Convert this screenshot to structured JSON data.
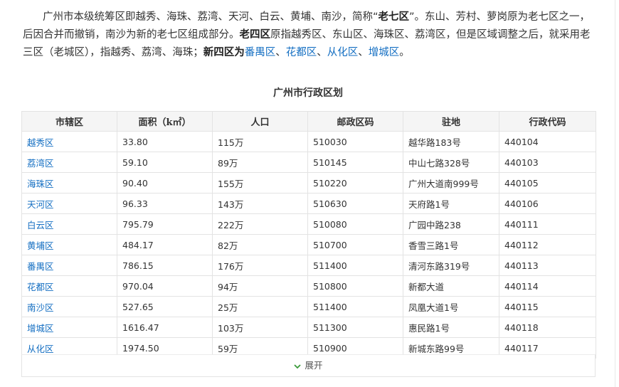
{
  "intro": {
    "p1": "广州市本级统筹区即越秀、海珠、荔湾、天河、白云、黄埔、南沙，简称“",
    "b1": "老七区",
    "p2": "”。东山、芳村、萝岗原为老七区之一，后因合并而撤销，南沙为新的老七区组成部分。",
    "b2": "老四区",
    "p3": "原指越秀区、东山区、海珠区、荔湾区，但是区域调整之后，就采用老三区（老城区），指越秀、荔湾、海珠；",
    "b3": "新四区",
    "p4": "为",
    "links": [
      "番禺区",
      "花都区",
      "从化区",
      "增城区"
    ],
    "sep": "、",
    "end": "。"
  },
  "table": {
    "caption": "广州市行政区划",
    "headers": [
      "市辖区",
      "面积（k㎡）",
      "人口",
      "邮政区码",
      "驻地",
      "行政代码"
    ],
    "rows": [
      [
        "越秀区",
        "33.80",
        "115万",
        "510030",
        "越华路183号",
        "440104"
      ],
      [
        "荔湾区",
        "59.10",
        "89万",
        "510145",
        "中山七路328号",
        "440103"
      ],
      [
        "海珠区",
        "90.40",
        "155万",
        "510220",
        "广州大道南999号",
        "440105"
      ],
      [
        "天河区",
        "96.33",
        "143万",
        "510630",
        "天府路1号",
        "440106"
      ],
      [
        "白云区",
        "795.79",
        "222万",
        "510080",
        "广园中路238",
        "440111"
      ],
      [
        "黄埔区",
        "484.17",
        "82万",
        "510700",
        "香雪三路1号",
        "440112"
      ],
      [
        "番禺区",
        "786.15",
        "176万",
        "511400",
        "清河东路319号",
        "440113"
      ],
      [
        "花都区",
        "970.04",
        "94万",
        "510800",
        "新都大道",
        "440114"
      ],
      [
        "南沙区",
        "527.65",
        "25万",
        "511400",
        "凤凰大道1号",
        "440115"
      ],
      [
        "增城区",
        "1616.47",
        "103万",
        "511300",
        "惠民路1号",
        "440118"
      ],
      [
        "从化区",
        "1974.50",
        "59万",
        "510900",
        "新城东路99号",
        "440117"
      ]
    ]
  },
  "expand": {
    "icon": "chevron-down-icon",
    "label": "展开"
  },
  "colors": {
    "link": "#136ec2",
    "header_bg": "#f5f5f5",
    "border": "#e3e3e3",
    "chevron": "#3a9a3a"
  }
}
